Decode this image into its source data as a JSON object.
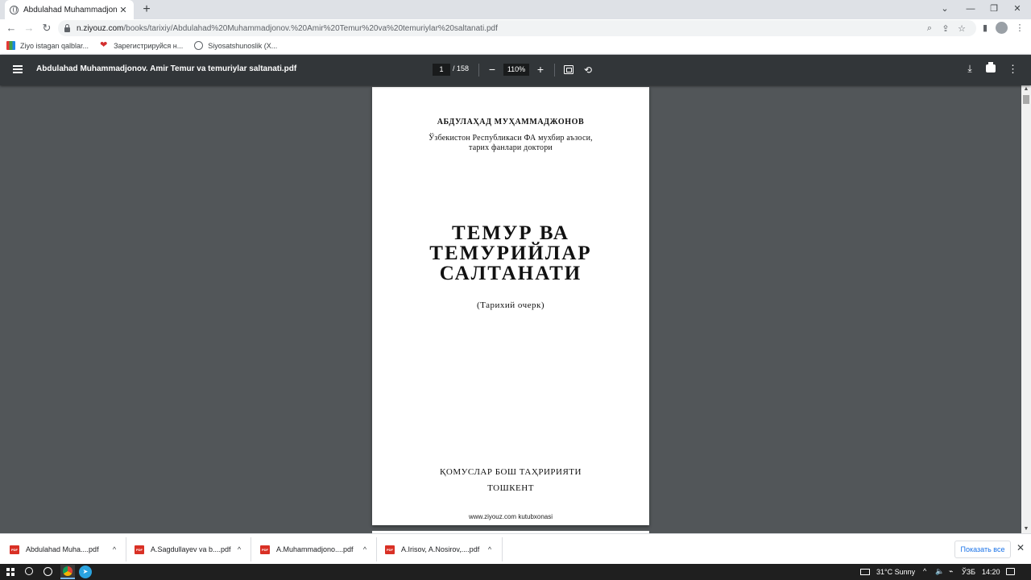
{
  "browser": {
    "tab_title": "Abdulahad Muhammadjonov. Am",
    "tab_close": "✕",
    "new_tab": "+",
    "window_controls": {
      "minimize": "⌄",
      "restore": "—",
      "maximize": "❐",
      "close": "✕"
    },
    "nav": {
      "back": "←",
      "forward": "→",
      "reload": "↻"
    },
    "url_host": "n.ziyouz.com",
    "url_path": "/books/tarixiy/Abdulahad%20Muhammadjonov.%20Amir%20Temur%20va%20temuriylar%20saltanati.pdf",
    "omnibox_icons": {
      "zoom": "⌕",
      "share": "⇪",
      "star": "☆"
    },
    "toolbar_icons": {
      "sidebar": "▮",
      "menu": "⋮"
    },
    "bookmarks": [
      {
        "label": "Ziyo istagan qalblar..."
      },
      {
        "label": "Зарегистрируйся н..."
      },
      {
        "label": "Siyosatshunoslik (X..."
      }
    ]
  },
  "pdf_toolbar": {
    "title": "Abdulahad Muhammadjonov. Amir Temur va temuriylar saltanati.pdf",
    "current_page": "1",
    "total_pages": "/ 158",
    "zoom": "110%",
    "zoom_out": "−",
    "zoom_in": "+",
    "rotate": "⟲",
    "download": "⤓",
    "more": "⋮"
  },
  "document": {
    "author": "АБДУЛАҲАД МУҲАММАДЖОНОВ",
    "affiliation_line1": "Ўзбекистон Республикаси ФА мухбир аъзоси,",
    "affiliation_line2": "тарих фанлари доктори",
    "title_line1": "ТЕМУР ВА",
    "title_line2": "ТЕМУРИЙЛАР",
    "title_line3": "САЛТАНАТИ",
    "subtitle": "(Тарихий очерк)",
    "publisher": "ҚОМУСЛАР БОШ ТАҲРИРИЯТИ",
    "city": "ТОШКЕНТ",
    "footer_site": "www.ziyouz.com kutubxonasi"
  },
  "scrollbar": {
    "up": "▲",
    "down": "▼"
  },
  "downloads": {
    "items": [
      {
        "name": "Abdulahad Muha....pdf",
        "icon": "PDF",
        "chevron": "^"
      },
      {
        "name": "A.Sagdullayev va b....pdf",
        "icon": "PDF",
        "chevron": "^"
      },
      {
        "name": "A.Muhammadjono....pdf",
        "icon": "PDF",
        "chevron": "^"
      },
      {
        "name": "A.Irisov, A.Nosirov,....pdf",
        "icon": "PDF",
        "chevron": "^"
      }
    ],
    "show_all": "Показать все",
    "close": "✕"
  },
  "taskbar": {
    "telegram": "➤",
    "weather": "31°C  Sunny",
    "up_arrow": "^",
    "volume": "🔈",
    "network": "⌁",
    "language": "ЎЗБ",
    "time": "14:20"
  }
}
